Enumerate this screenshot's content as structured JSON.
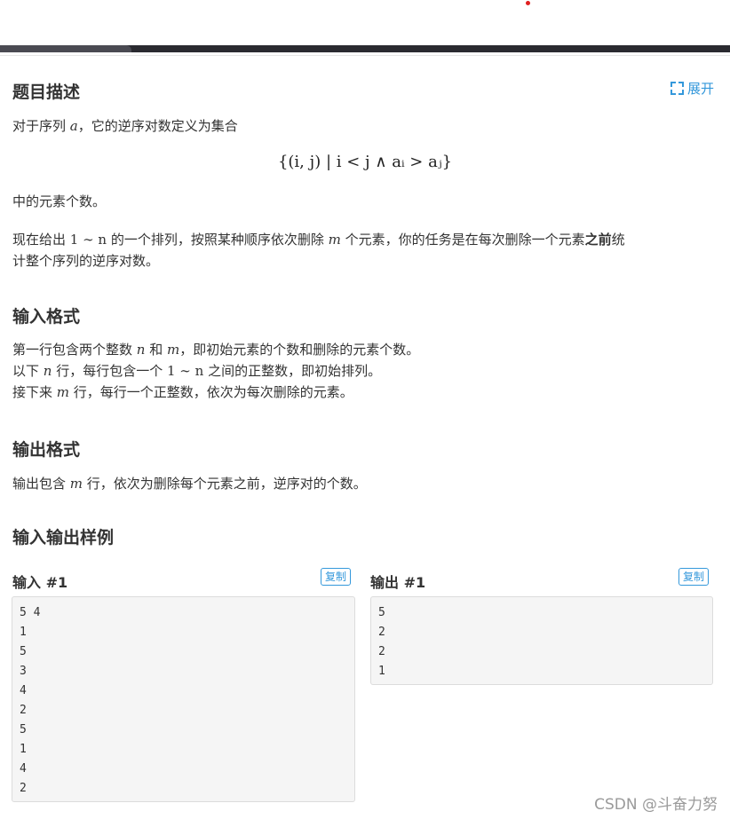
{
  "header": {
    "accent_bar_color": "#2a2a30"
  },
  "description": {
    "title": "题目描述",
    "expand_label": "展开",
    "p1_before": "对于序列 ",
    "p1_var": "a",
    "p1_after": "，它的逆序对数定义为集合",
    "formula": "{(i, j) | i < j ∧ aᵢ > aⱼ}",
    "p2": "中的元素个数。",
    "p3_a": "现在给出 ",
    "p3_range": "1 ∼ n",
    "p3_b": " 的一个排列，按照某种顺序依次删除 ",
    "p3_m": "m",
    "p3_c": " 个元素，你的任务是在每次删除一个元素",
    "p3_bold": "之前",
    "p3_d": "统",
    "p3_e": "计整个序列的逆序对数。"
  },
  "input_format": {
    "title": "输入格式",
    "l1_a": "第一行包含两个整数 ",
    "l1_n": "n",
    "l1_b": " 和 ",
    "l1_m": "m",
    "l1_c": "，即初始元素的个数和删除的元素个数。",
    "l2_a": "以下 ",
    "l2_n": "n",
    "l2_b": " 行，每行包含一个 ",
    "l2_range": "1 ∼ n",
    "l2_c": " 之间的正整数，即初始排列。",
    "l3_a": "接下来 ",
    "l3_m": "m",
    "l3_b": " 行，每行一个正整数，依次为每次删除的元素。"
  },
  "output_format": {
    "title": "输出格式",
    "l1_a": "输出包含 ",
    "l1_m": "m",
    "l1_b": " 行，依次为删除每个元素之前，逆序对的个数。"
  },
  "samples": {
    "title": "输入输出样例",
    "input_title": "输入 #1",
    "output_title": "输出 #1",
    "copy_label": "复制",
    "input_lines": [
      "5 4",
      "1",
      "5",
      "3",
      "4",
      "2",
      "5",
      "1",
      "4",
      "2"
    ],
    "output_lines": [
      "5",
      "2",
      "2",
      "1"
    ]
  },
  "watermark": "CSDN @斗奋力努"
}
